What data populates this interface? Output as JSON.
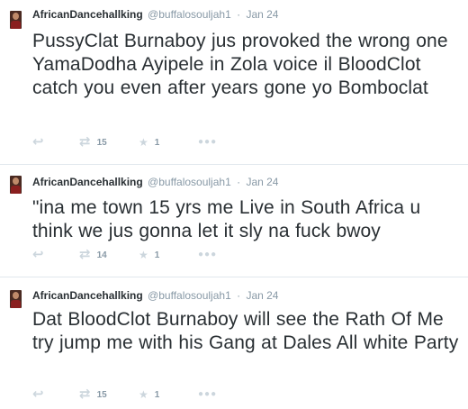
{
  "tweets": [
    {
      "fullname": "AfricanDancehallking",
      "username": "@buffalosouljah1",
      "separator": "·",
      "time": "Jan 24",
      "text": "PussyClat Burnaboy jus provoked the wrong one YamaDodha Ayipele in Zola voice il BloodClot catch you even after years gone yo Bomboclat",
      "retweets": "15",
      "favorites": "1"
    },
    {
      "fullname": "AfricanDancehallking",
      "username": "@buffalosouljah1",
      "separator": "·",
      "time": "Jan 24",
      "text": "\"ina me town 15 yrs me Live in South Africa u think we jus gonna let it sly na fuck bwoy",
      "retweets": "14",
      "favorites": "1"
    },
    {
      "fullname": "AfricanDancehallking",
      "username": "@buffalosouljah1",
      "separator": "·",
      "time": "Jan 24",
      "text": "Dat BloodClot Burnaboy will see the Rath Of Me try jump me with his Gang at Dales All white Party",
      "retweets": "15",
      "favorites": "1"
    }
  ],
  "icons": {
    "reply": "reply-icon",
    "retweet": "retweet-icon",
    "favorite": "star-icon",
    "more": "more-icon"
  },
  "colors": {
    "text": "#292f33",
    "secondary": "#8899a6",
    "icon": "#ccd6dd",
    "divider": "#e1e8ed"
  }
}
